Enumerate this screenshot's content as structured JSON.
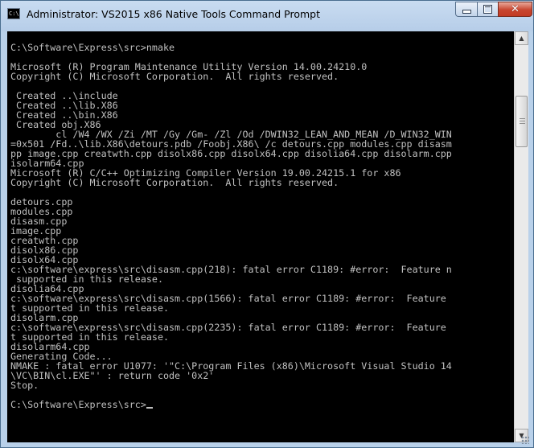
{
  "window": {
    "title": "Administrator: VS2015 x86 Native Tools Command Prompt",
    "app_icon": "C:\\",
    "controls": {
      "minimize_icon": "minimize-icon",
      "maximize_icon": "maximize-icon",
      "close_icon": "close-icon",
      "close_glyph": "✕"
    },
    "colors": {
      "console_background": "#000000",
      "console_text": "#c0c0c0",
      "close_button": "#c8452f",
      "frame": "#b9d1ea"
    }
  },
  "console": {
    "lines": [
      "",
      "C:\\Software\\Express\\src>nmake",
      "",
      "Microsoft (R) Program Maintenance Utility Version 14.00.24210.0",
      "Copyright (C) Microsoft Corporation.  All rights reserved.",
      "",
      " Created ..\\include",
      " Created ..\\lib.X86",
      " Created ..\\bin.X86",
      " Created obj.X86",
      "        cl /W4 /WX /Zi /MT /Gy /Gm- /Zl /Od /DWIN32_LEAN_AND_MEAN /D_WIN32_WIN",
      "=0x501 /Fd..\\lib.X86\\detours.pdb /Foobj.X86\\ /c detours.cpp modules.cpp disasm",
      "pp image.cpp creatwth.cpp disolx86.cpp disolx64.cpp disolia64.cpp disolarm.cpp",
      "isolarm64.cpp",
      "Microsoft (R) C/C++ Optimizing Compiler Version 19.00.24215.1 for x86",
      "Copyright (C) Microsoft Corporation.  All rights reserved.",
      "",
      "detours.cpp",
      "modules.cpp",
      "disasm.cpp",
      "image.cpp",
      "creatwth.cpp",
      "disolx86.cpp",
      "disolx64.cpp",
      "c:\\software\\express\\src\\disasm.cpp(218): fatal error C1189: #error:  Feature n",
      " supported in this release.",
      "disolia64.cpp",
      "c:\\software\\express\\src\\disasm.cpp(1566): fatal error C1189: #error:  Feature",
      "t supported in this release.",
      "disolarm.cpp",
      "c:\\software\\express\\src\\disasm.cpp(2235): fatal error C1189: #error:  Feature",
      "t supported in this release.",
      "disolarm64.cpp",
      "Generating Code...",
      "NMAKE : fatal error U1077: '\"C:\\Program Files (x86)\\Microsoft Visual Studio 14",
      "\\VC\\BIN\\cl.EXE\"' : return code '0x2'",
      "Stop.",
      "",
      "C:\\Software\\Express\\src>"
    ]
  },
  "scrollbar": {
    "up_icon": "scroll-up-arrow-icon",
    "down_icon": "scroll-down-arrow-icon",
    "up_glyph": "▲",
    "down_glyph": "▼"
  }
}
